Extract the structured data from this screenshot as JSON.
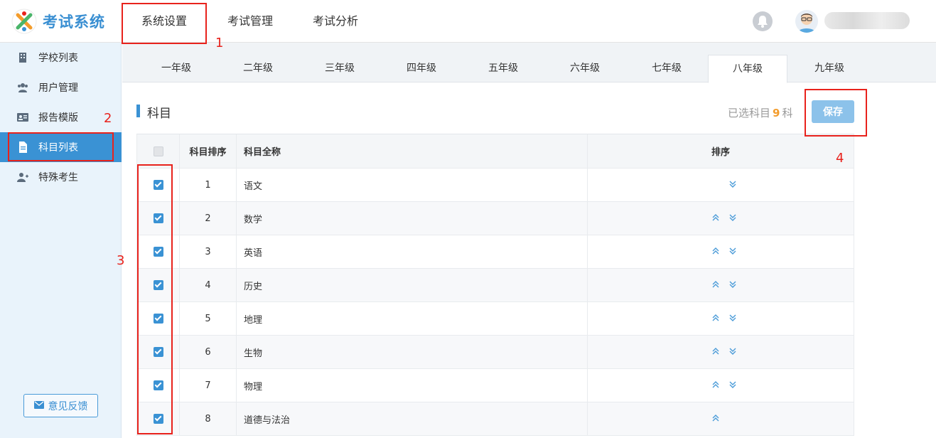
{
  "app": {
    "logo_text": "考试系统"
  },
  "nav": {
    "items": [
      {
        "label": "系统设置"
      },
      {
        "label": "考试管理"
      },
      {
        "label": "考试分析"
      }
    ]
  },
  "sidebar": {
    "items": [
      {
        "label": "学校列表",
        "icon": "building-icon"
      },
      {
        "label": "用户管理",
        "icon": "users-icon"
      },
      {
        "label": "报告模版",
        "icon": "id-card-icon"
      },
      {
        "label": "科目列表",
        "icon": "document-icon"
      },
      {
        "label": "特殊考生",
        "icon": "user-plus-icon"
      }
    ],
    "active_index": 3,
    "feedback_label": "意见反馈"
  },
  "tabs": {
    "items": [
      "一年级",
      "二年级",
      "三年级",
      "四年级",
      "五年级",
      "六年级",
      "七年级",
      "八年级",
      "九年级"
    ],
    "active_index": 7
  },
  "section": {
    "title": "科目",
    "selected_prefix": "已选科目",
    "selected_count": "9",
    "selected_suffix": "科",
    "save_label": "保存"
  },
  "table": {
    "headers": {
      "order": "科目排序",
      "name": "科目全称",
      "sort": "排序"
    },
    "rows": [
      {
        "order": "1",
        "name": "语文",
        "checked": true
      },
      {
        "order": "2",
        "name": "数学",
        "checked": true
      },
      {
        "order": "3",
        "name": "英语",
        "checked": true
      },
      {
        "order": "4",
        "name": "历史",
        "checked": true
      },
      {
        "order": "5",
        "name": "地理",
        "checked": true
      },
      {
        "order": "6",
        "name": "生物",
        "checked": true
      },
      {
        "order": "7",
        "name": "物理",
        "checked": true
      },
      {
        "order": "8",
        "name": "道德与法治",
        "checked": true
      }
    ]
  },
  "annotations": [
    "1",
    "2",
    "3",
    "4"
  ],
  "colors": {
    "accent": "#3a92d4",
    "annotation": "#e8221c",
    "count": "#f39c2c"
  }
}
